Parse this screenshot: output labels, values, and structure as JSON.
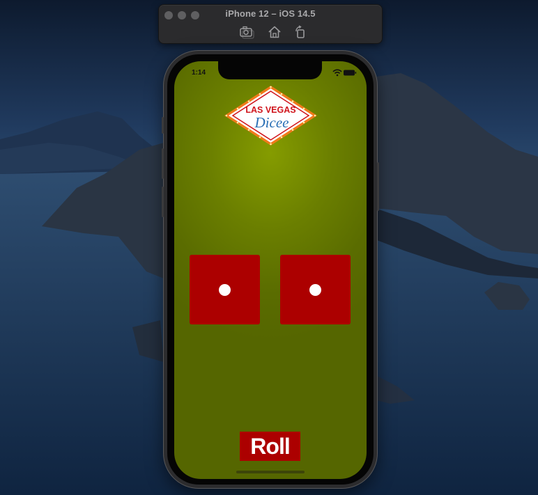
{
  "simulator": {
    "title": "iPhone 12 – iOS 14.5",
    "toolbar_buttons": [
      "screenshot-icon",
      "home-icon",
      "rotate-icon"
    ]
  },
  "status_bar": {
    "time": "1:14",
    "icons": [
      "wifi-icon",
      "battery-icon"
    ]
  },
  "logo": {
    "line1": "LAS VEGAS",
    "line2": "Dicee"
  },
  "dice": [
    {
      "name": "left",
      "value": 1
    },
    {
      "name": "right",
      "value": 1
    }
  ],
  "roll_button": {
    "label": "Roll"
  },
  "colors": {
    "felt": "#6b7f00",
    "die": "#ac0000",
    "pip": "#ffffff",
    "button": "#ac0000",
    "logo_red": "#d0141c",
    "logo_blue": "#2a6fb5",
    "marquee_orange": "#f07a1a"
  }
}
